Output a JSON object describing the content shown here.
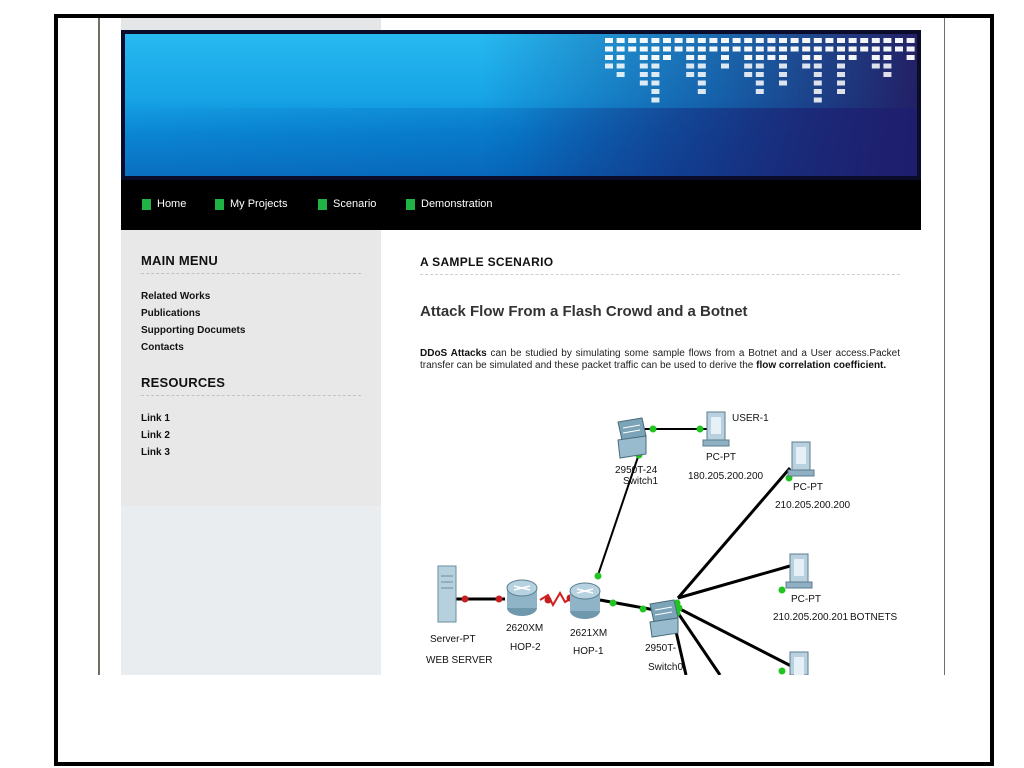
{
  "nav": {
    "items": [
      {
        "label": "Home"
      },
      {
        "label": "My Projects"
      },
      {
        "label": "Scenario"
      },
      {
        "label": "Demonstration"
      }
    ]
  },
  "sidebar": {
    "main_menu": {
      "heading": "MAIN MENU",
      "links": [
        {
          "label": "Related Works"
        },
        {
          "label": "Publications"
        },
        {
          "label": "Supporting Documets"
        },
        {
          "label": "Contacts"
        }
      ]
    },
    "resources": {
      "heading": "RESOURCES",
      "links": [
        {
          "label": "Link 1"
        },
        {
          "label": "Link 2"
        },
        {
          "label": "Link 3"
        }
      ]
    }
  },
  "main": {
    "section_heading": "A SAMPLE SCENARIO",
    "article_title": "Attack Flow From a Flash Crowd and a Botnet",
    "paragraph": {
      "bold_start": "DDoS Attacks",
      "text": " can be studied by simulating some sample flows from a Botnet and a User access.Packet transfer can be simulated and these packet traffic can be used to derive the ",
      "bold_end": "flow correlation coefficient."
    }
  },
  "diagram": {
    "switch1": {
      "model": "2950T-24",
      "name": "Switch1"
    },
    "user_pc": {
      "label": "USER-1",
      "type": "PC-PT",
      "ip": "180.205.200.200"
    },
    "bot_pc_1": {
      "type": "PC-PT",
      "ip": "210.205.200.200"
    },
    "bot_pc_2": {
      "type": "PC-PT",
      "ip": "210.205.200.201"
    },
    "botnets_label": "BOTNETS",
    "server": {
      "type": "Server-PT",
      "name": "WEB SERVER"
    },
    "router2": {
      "model": "2620XM",
      "name": "HOP-2"
    },
    "router1": {
      "model": "2621XM",
      "name": "HOP-1"
    },
    "switch0": {
      "model": "2950T-",
      "name": "Switch0"
    }
  },
  "colors": {
    "nav_bullet": "#1fb245",
    "link_green": "#22c422",
    "link_red": "#d21e1e"
  }
}
